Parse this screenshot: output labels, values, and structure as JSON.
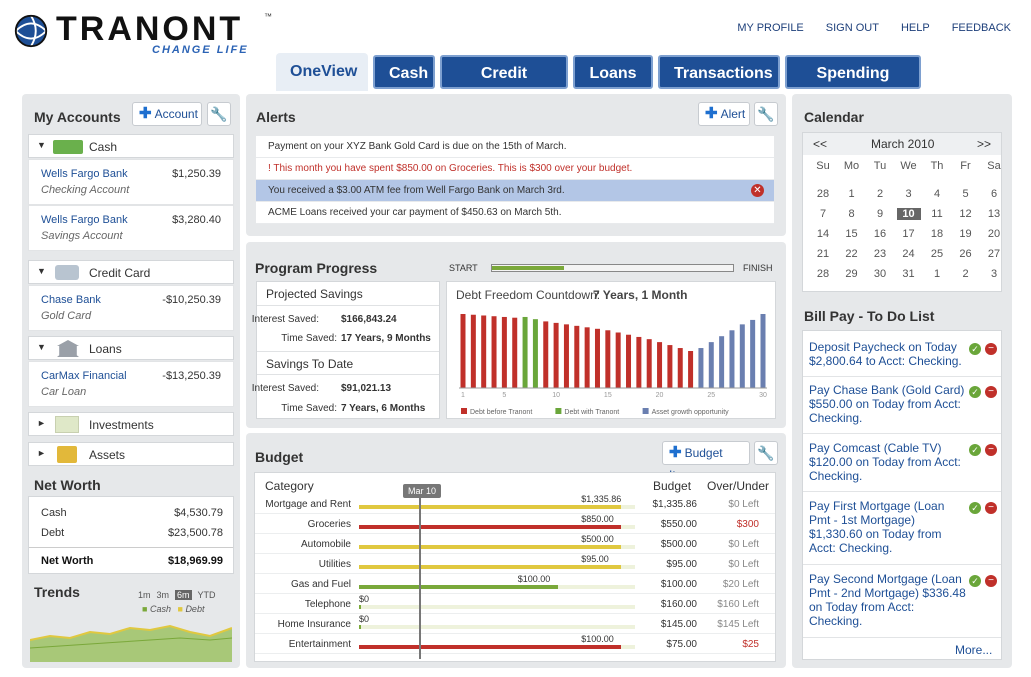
{
  "brand": {
    "name": "TRANONT",
    "tagline": "CHANGE LIFE",
    "tm": "™"
  },
  "toplinks": [
    "MY PROFILE",
    "SIGN OUT",
    "HELP",
    "FEEDBACK"
  ],
  "tabs": [
    "OneView",
    "Cash",
    "Credit Cards",
    "Loans",
    "Transactions",
    "Spending Plan"
  ],
  "accounts": {
    "title": "My Accounts",
    "add_label": "Account",
    "groups": {
      "cash": {
        "label": "Cash",
        "items": [
          {
            "name": "Wells Fargo Bank",
            "type": "Checking Account",
            "value": "$1,250.39"
          },
          {
            "name": "Wells Fargo Bank",
            "type": "Savings Account",
            "value": "$3,280.40"
          }
        ]
      },
      "credit": {
        "label": "Credit Card",
        "items": [
          {
            "name": "Chase Bank",
            "type": "Gold Card",
            "value": "-$10,250.39"
          }
        ]
      },
      "loans": {
        "label": "Loans",
        "items": [
          {
            "name": "CarMax Financial",
            "type": "Car Loan",
            "value": "-$13,250.39"
          }
        ]
      },
      "investments": {
        "label": "Investments"
      },
      "assets": {
        "label": "Assets"
      }
    }
  },
  "networth": {
    "title": "Net Worth",
    "rows": [
      {
        "label": "Cash",
        "value": "$4,530.79"
      },
      {
        "label": "Debt",
        "value": "$23,500.78"
      }
    ],
    "total_label": "Net Worth",
    "total_value": "$18,969.99"
  },
  "trends": {
    "title": "Trends",
    "ranges": [
      "1m",
      "3m",
      "6m",
      "YTD"
    ],
    "active": "6m",
    "legend": [
      "Cash",
      "Debt"
    ],
    "colors": {
      "cash": "#7aa83a",
      "debt": "#e0c840"
    }
  },
  "alerts": {
    "title": "Alerts",
    "add_label": "Alert",
    "items": [
      "Payment on your XYZ Bank Gold Card is due on the 15th of March.",
      "! This month you have spent $850.00 on Groceries.  This is $300 over your budget.",
      "You received a $3.00 ATM fee from Well Fargo Bank on March 3rd.",
      "ACME Loans received your car payment of $450.63 on March 5th."
    ]
  },
  "progress": {
    "title": "Program Progress",
    "start": "START",
    "finish": "FINISH",
    "progress": 0.3,
    "projected": {
      "title": "Projected Savings",
      "interest_label": "Interest Saved:",
      "interest": "$166,843.24",
      "time_label": "Time Saved:",
      "time": "17 Years, 9 Months"
    },
    "todate": {
      "title": "Savings To Date",
      "interest_label": "Interest Saved:",
      "interest": "$91,021.13",
      "time_label": "Time Saved:",
      "time": "7 Years, 6 Months"
    },
    "countdown_label": "Debt Freedom Countdown:",
    "countdown": "7 Years, 1 Month"
  },
  "chart_data": {
    "type": "bar",
    "x": [
      1,
      2,
      3,
      4,
      5,
      6,
      7,
      8,
      9,
      10,
      11,
      12,
      13,
      14,
      15,
      16,
      17,
      18,
      19,
      20,
      21,
      22,
      23,
      24,
      25,
      26,
      27,
      28,
      29,
      30
    ],
    "xticks": [
      "1",
      "5",
      "10",
      "15",
      "20",
      "25",
      "30"
    ],
    "series": [
      {
        "name": "Debt before Tranont",
        "color": "#c0302a",
        "values": [
          100,
          99,
          98,
          97,
          96,
          95,
          94,
          92,
          90,
          88,
          86,
          84,
          82,
          80,
          78,
          75,
          72,
          69,
          66,
          62,
          58,
          54,
          50,
          46,
          41,
          36,
          31,
          26,
          0,
          0
        ]
      },
      {
        "name": "Debt with Tranont",
        "color": "#6aa63a",
        "values": [
          0,
          0,
          0,
          0,
          0,
          0,
          96,
          93,
          88,
          82,
          75,
          68,
          60,
          52,
          44,
          36,
          28,
          20,
          12,
          5,
          0,
          0,
          0,
          0,
          0,
          0,
          0,
          0,
          0,
          0
        ]
      },
      {
        "name": "Asset growth opportunity",
        "color": "#6a7fb0",
        "values": [
          0,
          0,
          0,
          0,
          0,
          0,
          0,
          0,
          0,
          0,
          0,
          0,
          0,
          0,
          0,
          0,
          0,
          0,
          0,
          0,
          30,
          38,
          46,
          54,
          62,
          70,
          78,
          86,
          92,
          100
        ]
      }
    ],
    "ylim": [
      0,
      100
    ]
  },
  "budget": {
    "title": "Budget",
    "add_label": "Budget Item",
    "col_category": "Category",
    "col_budget": "Budget",
    "col_over": "Over/Under",
    "marker": "Mar 10",
    "rows": [
      {
        "category": "Mortgage and Rent",
        "spent_label": "$1,335.86",
        "spent_frac": 0.95,
        "budget": "$1,335.86",
        "over": "$0 Left",
        "color": "#e0c840",
        "over_color": "#888"
      },
      {
        "category": "Groceries",
        "spent_label": "$850.00",
        "spent_frac": 0.95,
        "budget": "$550.00",
        "over": "$300",
        "color": "#c0302a",
        "over_color": "#c0302a"
      },
      {
        "category": "Automobile",
        "spent_label": "$500.00",
        "spent_frac": 0.95,
        "budget": "$500.00",
        "over": "$0 Left",
        "color": "#e0c840",
        "over_color": "#888"
      },
      {
        "category": "Utilities",
        "spent_label": "$95.00",
        "spent_frac": 0.95,
        "budget": "$95.00",
        "over": "$0 Left",
        "color": "#e0c840",
        "over_color": "#888"
      },
      {
        "category": "Gas and Fuel",
        "spent_label": "$100.00",
        "spent_frac": 0.72,
        "budget": "$100.00",
        "over": "$20 Left",
        "color": "#7aa83a",
        "over_color": "#888"
      },
      {
        "category": "Telephone",
        "spent_label": "$0",
        "spent_frac": 0.0,
        "budget": "$160.00",
        "over": "$160 Left",
        "color": "#7aa83a",
        "over_color": "#888"
      },
      {
        "category": "Home Insurance",
        "spent_label": "$0",
        "spent_frac": 0.0,
        "budget": "$145.00",
        "over": "$145 Left",
        "color": "#7aa83a",
        "over_color": "#888"
      },
      {
        "category": "Entertainment",
        "spent_label": "$100.00",
        "spent_frac": 0.95,
        "budget": "$75.00",
        "over": "$25",
        "color": "#c0302a",
        "over_color": "#c0302a"
      }
    ]
  },
  "calendar": {
    "title": "Calendar",
    "month": "March 2010",
    "prev": "<<",
    "next": ">>",
    "days": [
      "Su",
      "Mo",
      "Tu",
      "We",
      "Th",
      "Fr",
      "Sa"
    ],
    "weeks": [
      [
        "28",
        "1",
        "2",
        "3",
        "4",
        "5",
        "6"
      ],
      [
        "7",
        "8",
        "9",
        "10",
        "11",
        "12",
        "13"
      ],
      [
        "14",
        "15",
        "16",
        "17",
        "18",
        "19",
        "20"
      ],
      [
        "21",
        "22",
        "23",
        "24",
        "25",
        "26",
        "27"
      ],
      [
        "28",
        "29",
        "30",
        "31",
        "1",
        "2",
        "3"
      ]
    ],
    "today": "10"
  },
  "billpay": {
    "title": "Bill Pay - To Do List",
    "items": [
      "Deposit Paycheck on Today $2,800.64 to Acct: Checking.",
      "Pay Chase Bank (Gold Card) $550.00 on Today from Acct: Checking.",
      "Pay Comcast (Cable TV) $120.00 on Today from Acct: Checking.",
      "Pay First Mortgage (Loan Pmt - 1st Mortgage) $1,330.60 on Today from Acct: Checking.",
      "Pay Second Mortgage (Loan Pmt - 2nd Mortgage) $336.48 on Today from Acct: Checking."
    ],
    "more": "More..."
  }
}
